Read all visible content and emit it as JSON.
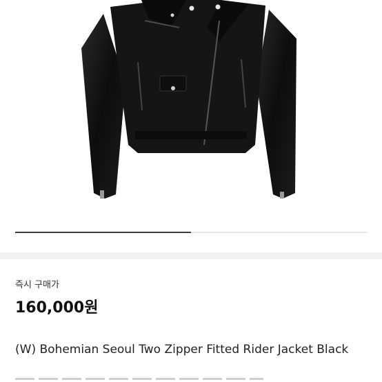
{
  "product": {
    "image_icon": "leather-rider-jacket",
    "image_progress": 0.5,
    "purchase_label": "즉시 구매가",
    "price": "160,000원",
    "title": "(W) Bohemian Seoul Two Zipper Fitted Rider Jacket Black"
  }
}
